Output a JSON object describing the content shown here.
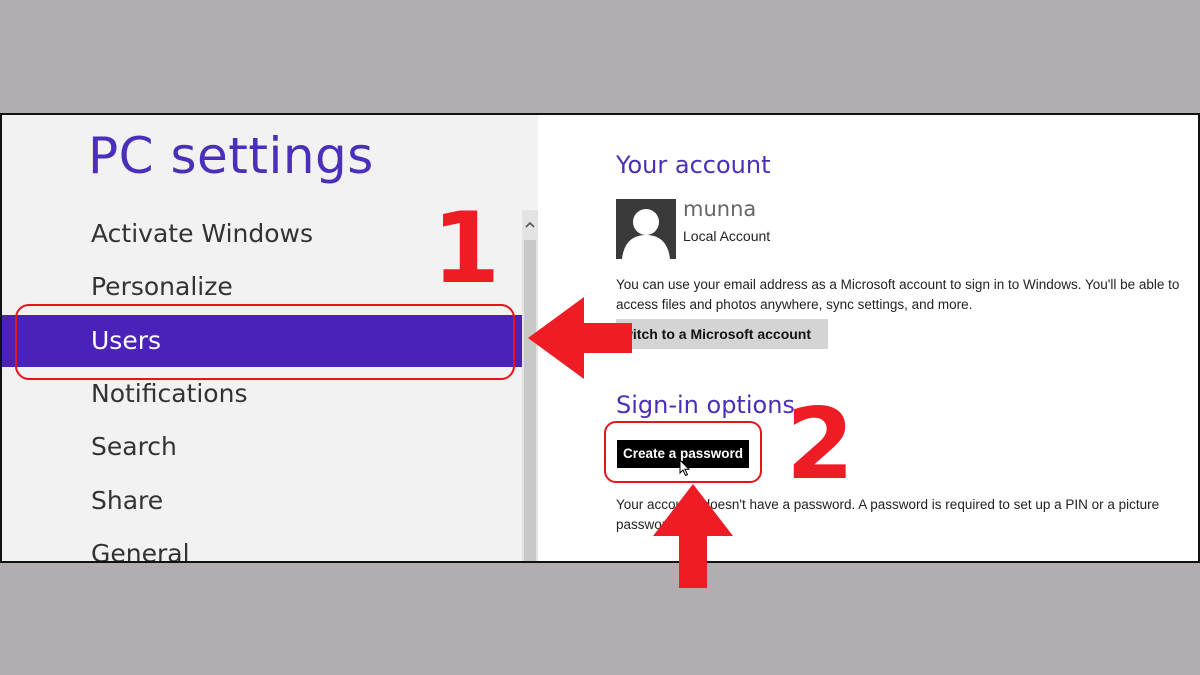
{
  "window": {
    "title": "PC settings"
  },
  "sidebar": {
    "items": [
      {
        "label": "Activate Windows"
      },
      {
        "label": "Personalize"
      },
      {
        "label": "Users",
        "selected": true
      },
      {
        "label": "Notifications"
      },
      {
        "label": "Search"
      },
      {
        "label": "Share"
      },
      {
        "label": "General"
      }
    ]
  },
  "account": {
    "section_title": "Your account",
    "user_name": "munna",
    "account_type": "Local Account",
    "description": "You can use your email address as a Microsoft account to sign in to Windows. You'll be able to access files and photos anywhere, sync settings, and more.",
    "switch_button": "witch to a Microsoft account"
  },
  "signin": {
    "section_title": "Sign-in options",
    "create_password_button": "Create a password",
    "description_part1": "Your accou",
    "description_part2": "doesn't have a password. A password is required to set up a PIN or a picture",
    "description_part3": "passwor"
  },
  "annotations": {
    "step1": "1",
    "step2": "2",
    "color": "#ee1c25"
  },
  "colors": {
    "accent": "#4a22b9",
    "title": "#4b2fb8",
    "background": "#b2adb1"
  },
  "icons": {
    "avatar": "user-avatar-icon",
    "scroll_up": "chevron-up-icon",
    "cursor": "mouse-pointer-icon",
    "arrow_left": "red-arrow-left-icon",
    "arrow_up": "red-arrow-up-icon"
  }
}
